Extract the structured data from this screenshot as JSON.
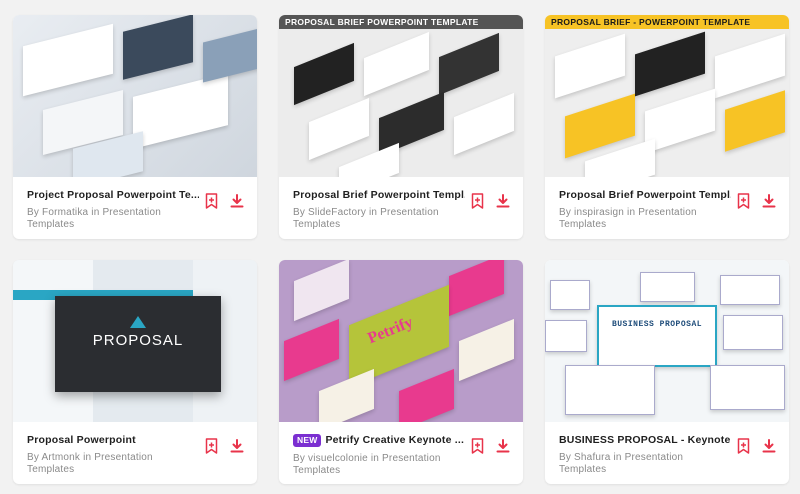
{
  "cards": [
    {
      "title": "Project Proposal Powerpoint Te...",
      "author_line": "By Formatika in Presentation",
      "category_line": "Templates",
      "bookmark_icon": "bookmark-add-icon",
      "download_icon": "download-icon"
    },
    {
      "title": "Proposal Brief Powerpoint Templ...",
      "author_line": "By SlideFactory in Presentation",
      "category_line": "Templates",
      "banner": "PROPOSAL BRIEF POWERPOINT TEMPLATE",
      "bookmark_icon": "bookmark-add-icon",
      "download_icon": "download-icon"
    },
    {
      "title": "Proposal Brief Powerpoint Templ...",
      "author_line": "By inspirasign in Presentation",
      "category_line": "Templates",
      "banner": "PROPOSAL BRIEF - POWERPOINT TEMPLATE",
      "bookmark_icon": "bookmark-add-icon",
      "download_icon": "download-icon"
    },
    {
      "title": "Proposal Powerpoint",
      "author_line": "By Artmonk in Presentation",
      "category_line": "Templates",
      "thumb_text": "PROPOSAL",
      "bookmark_icon": "bookmark-add-icon",
      "download_icon": "download-icon"
    },
    {
      "badge": "NEW",
      "title": "Petrify Creative Keynote ...",
      "author_line": "By visuelcolonie in Presentation",
      "category_line": "Templates",
      "thumb_text": "Petrify",
      "bookmark_icon": "bookmark-add-icon",
      "download_icon": "download-icon"
    },
    {
      "title": "BUSINESS PROPOSAL - Keynote ...",
      "author_line": "By Shafura in Presentation",
      "category_line": "Templates",
      "thumb_text": "BUSINESS PROPOSAL",
      "bookmark_icon": "bookmark-add-icon",
      "download_icon": "download-icon"
    }
  ],
  "colors": {
    "accent": "#e8334a",
    "badge": "#7b2fd1",
    "banner_yellow": "#f7c325"
  }
}
